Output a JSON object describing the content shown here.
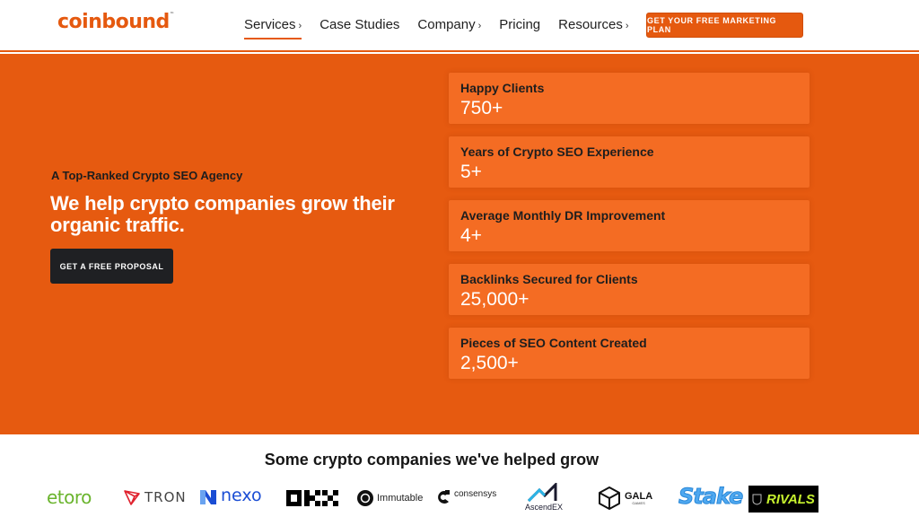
{
  "header": {
    "brand": "coinbound",
    "brand_tm": "™",
    "nav": [
      {
        "label": "Services",
        "chevron": "›",
        "active": true
      },
      {
        "label": "Case Studies",
        "chevron": "",
        "active": false
      },
      {
        "label": "Company",
        "chevron": "›",
        "active": false
      },
      {
        "label": "Pricing",
        "chevron": "",
        "active": false
      },
      {
        "label": "Resources",
        "chevron": "›",
        "active": false
      }
    ],
    "cta_label": "GET YOUR FREE MARKETING PLAN"
  },
  "hero": {
    "eyebrow": "A Top-Ranked Crypto SEO Agency",
    "headline": "We help crypto companies grow their organic traffic.",
    "cta_label": "GET A FREE PROPOSAL"
  },
  "stats": [
    {
      "label": "Happy Clients",
      "value": "750+"
    },
    {
      "label": "Years of Crypto SEO Experience",
      "value": "5+"
    },
    {
      "label": "Average Monthly DR Improvement",
      "value": "4+"
    },
    {
      "label": "Backlinks Secured for Clients",
      "value": "25,000+"
    },
    {
      "label": "Pieces of SEO Content Created",
      "value": "2,500+"
    }
  ],
  "clients": {
    "title": "Some crypto companies we've helped grow",
    "logos": {
      "etoro": "etoro",
      "tron": "TRON",
      "nexo": "nexo",
      "okx": "OKX",
      "immutable": "Immutable",
      "consensys": "consensys",
      "ascendex": "AscendEX",
      "gala": "GALA",
      "gala_sub": "GAMES",
      "stake": "Stake",
      "rivals": "RIVALS"
    }
  },
  "colors": {
    "brand_orange": "#e5590f",
    "card_orange": "#f46c23",
    "dark_button": "#1f2023"
  }
}
